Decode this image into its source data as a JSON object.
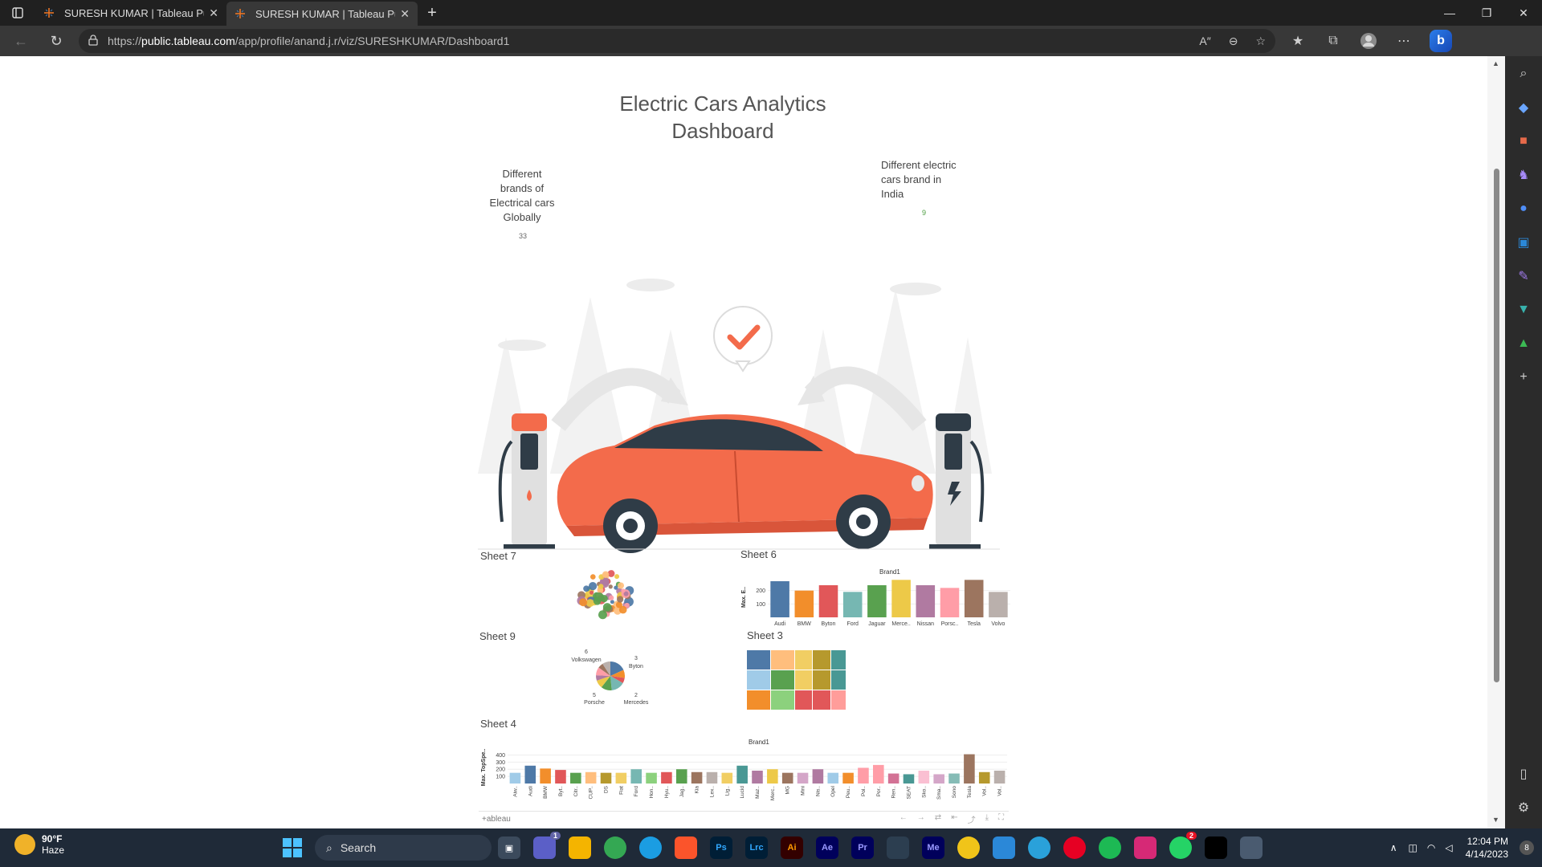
{
  "browser": {
    "tabs": [
      {
        "title": "SURESH KUMAR | Tableau Public",
        "close": "✕"
      },
      {
        "title": "SURESH KUMAR | Tableau Public",
        "close": "✕"
      }
    ],
    "new_tab": "+",
    "url_prefix": "https://",
    "url_domain": "public.tableau.com",
    "url_path": "/app/profile/anand.j.r/viz/SURESHKUMAR/Dashboard1"
  },
  "dashboard": {
    "title_line1": "Electric Cars Analytics",
    "title_line2": "Dashboard",
    "kpi_global_label_lines": [
      "Different",
      "brands of",
      "Electrical cars",
      "Globally"
    ],
    "kpi_global_value": "33",
    "kpi_india_label_lines": [
      "Different electric",
      "cars brand in",
      "India"
    ],
    "kpi_india_value": "9"
  },
  "sheets": {
    "sheet7": "Sheet 7",
    "sheet6": "Sheet 6",
    "sheet9": "Sheet 9",
    "sheet3": "Sheet 3",
    "sheet4": "Sheet 4"
  },
  "chart_data": [
    {
      "id": "sheet6",
      "type": "bar",
      "title": "Brand1",
      "ylabel": "Max. E..",
      "yticks": [
        100,
        200
      ],
      "ylim": [
        0,
        300
      ],
      "categories": [
        "Audi",
        "BMW",
        "Byton",
        "Ford",
        "Jaguar",
        "Merce..",
        "Nissan",
        "Porsc..",
        "Tesla",
        "Volvo"
      ],
      "values": [
        270,
        200,
        240,
        190,
        240,
        280,
        240,
        220,
        280,
        190
      ],
      "colors": [
        "#4e79a7",
        "#f28e2b",
        "#e15759",
        "#76b7b2",
        "#59a14f",
        "#edc948",
        "#b07aa1",
        "#ff9da7",
        "#9c755f",
        "#bab0ac"
      ]
    },
    {
      "id": "sheet9",
      "type": "pie",
      "labels": [
        {
          "value": "6",
          "name": "Volkswagen"
        },
        {
          "value": "3",
          "name": "Byton"
        },
        {
          "value": "5",
          "name": "Porsche"
        },
        {
          "value": "2",
          "name": "Mercedes"
        }
      ],
      "slice_values": [
        6,
        3,
        2,
        5,
        4,
        3,
        2,
        3,
        2,
        3
      ],
      "slice_colors": [
        "#4e79a7",
        "#f28e2b",
        "#e15759",
        "#76b7b2",
        "#59a14f",
        "#edc948",
        "#b07aa1",
        "#ff9da7",
        "#9c755f",
        "#bab0ac"
      ]
    },
    {
      "id": "sheet3",
      "type": "heatmap",
      "cells": [
        {
          "color": "#4e79a7"
        },
        {
          "color": "#ffbe7d"
        },
        {
          "color": "#f1ce63"
        },
        {
          "color": "#b6992d"
        },
        {
          "color": "#499894"
        },
        {
          "color": "#a0cbe8"
        },
        {
          "color": "#59a14f"
        },
        {
          "color": "#f1ce63"
        },
        {
          "color": "#b6992d"
        },
        {
          "color": "#499894"
        },
        {
          "color": "#f28e2b"
        },
        {
          "color": "#8cd17d"
        },
        {
          "color": "#e15759"
        },
        {
          "color": "#e15759"
        },
        {
          "color": "#ff9d9a"
        }
      ]
    },
    {
      "id": "sheet4",
      "type": "bar",
      "title": "Brand1",
      "ylabel": "Max. TopSpe..",
      "yticks": [
        100,
        200,
        300,
        400
      ],
      "ylim": [
        0,
        450
      ],
      "categories": [
        "Aiw..",
        "Audi",
        "BMW",
        "Byt..",
        "Citr..",
        "CUP..",
        "DS",
        "Fiat",
        "Ford",
        "Hon..",
        "Hyu..",
        "Jag..",
        "Kia",
        "Lex..",
        "Lig..",
        "Lucid",
        "Maz..",
        "Merc..",
        "MG",
        "Mini",
        "Nis..",
        "Opel",
        "Peu..",
        "Pol..",
        "Por..",
        "Ren..",
        "SEAT",
        "Sko..",
        "Sma..",
        "Sono",
        "Tesla",
        "Vol..",
        "Vol.."
      ],
      "values": [
        150,
        250,
        210,
        190,
        150,
        160,
        150,
        150,
        200,
        150,
        160,
        200,
        160,
        160,
        150,
        250,
        180,
        200,
        150,
        150,
        200,
        150,
        150,
        220,
        260,
        140,
        130,
        180,
        130,
        140,
        410,
        160,
        180
      ],
      "colors": [
        "#a0cbe8",
        "#4e79a7",
        "#f28e2b",
        "#e15759",
        "#59a14f",
        "#ffbe7d",
        "#b6992d",
        "#f1ce63",
        "#76b7b2",
        "#8cd17d",
        "#e15759",
        "#59a14f",
        "#9c755f",
        "#bab0ac",
        "#f1ce63",
        "#499894",
        "#b07aa1",
        "#edc948",
        "#9c755f",
        "#d4a6c8",
        "#b07aa1",
        "#a0cbe8",
        "#f28e2b",
        "#ff9da7",
        "#ff9da7",
        "#d37295",
        "#499894",
        "#fabfd2",
        "#d4a6c8",
        "#86bcb6",
        "#9c755f",
        "#b6992d",
        "#bab0ac"
      ]
    }
  ],
  "tableau_toolbar": {
    "brand": "+ableau"
  },
  "taskbar": {
    "weather_temp": "90°F",
    "weather_desc": "Haze",
    "search": "Search",
    "time": "12:04 PM",
    "date": "4/14/2023",
    "notifications": "8",
    "teams_badge": "1",
    "whatsapp_badge": "2",
    "apps": [
      "Ps",
      "Lrc",
      "Ai",
      "Ae",
      "Pr",
      "Me"
    ]
  }
}
